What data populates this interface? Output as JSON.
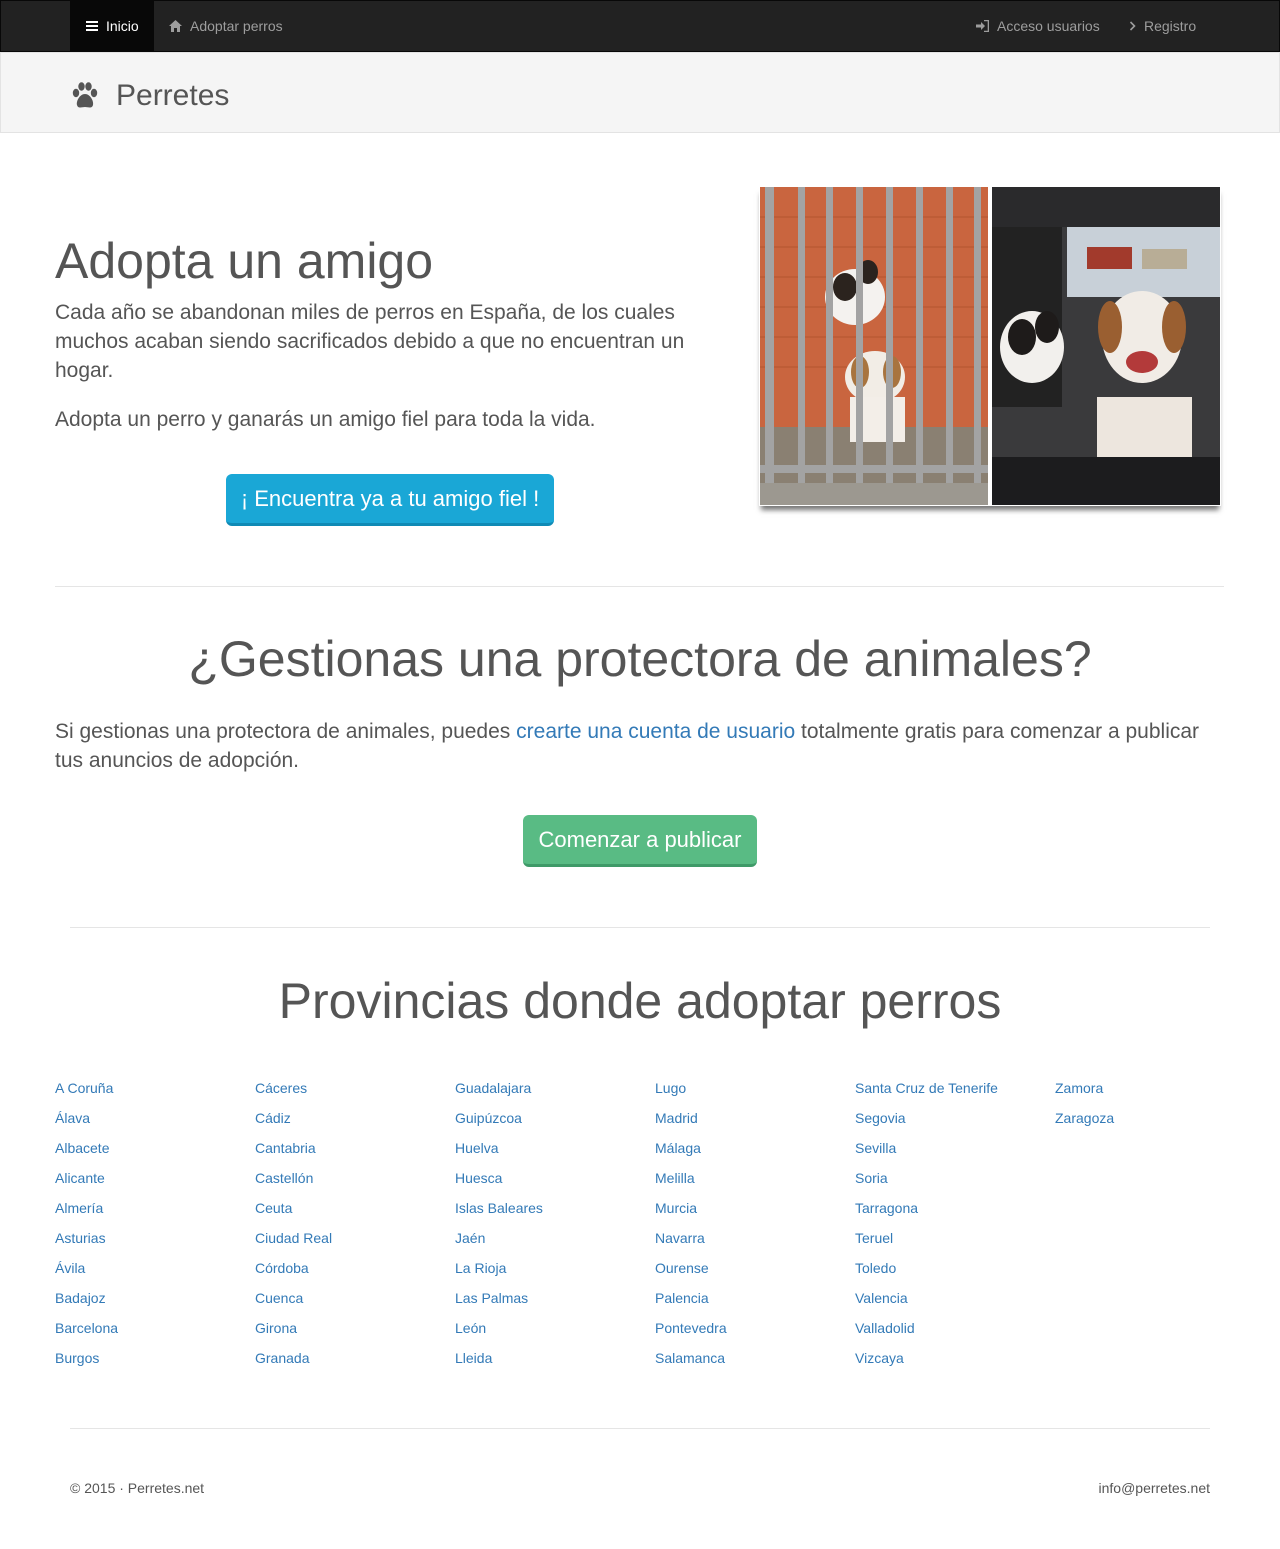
{
  "nav": {
    "inicio": "Inicio",
    "adoptar": "Adoptar perros",
    "acceso": "Acceso usuarios",
    "registro": "Registro"
  },
  "brand": {
    "name": "Perretes"
  },
  "hero": {
    "title": "Adopta un amigo",
    "paragraph1": "Cada año se abandonan miles de perros en España, de los cuales muchos acaban siendo sacrificados debido a que no encuentran un hogar.",
    "paragraph2": "Adopta un perro y ganarás un amigo fiel para toda la vida.",
    "button": "¡ Encuentra ya a tu amigo fiel !"
  },
  "protectora": {
    "title": "¿Gestionas una protectora de animales?",
    "text_before": "Si gestionas una protectora de animales, puedes ",
    "link": "crearte una cuenta de usuario",
    "text_after": " totalmente gratis para comenzar a publicar tus anuncios de adopción.",
    "button": "Comenzar a publicar"
  },
  "provincias": {
    "title": "Provincias donde adoptar perros",
    "columns": [
      [
        "A Coruña",
        "Álava",
        "Albacete",
        "Alicante",
        "Almería",
        "Asturias",
        "Ávila",
        "Badajoz",
        "Barcelona",
        "Burgos"
      ],
      [
        "Cáceres",
        "Cádiz",
        "Cantabria",
        "Castellón",
        "Ceuta",
        "Ciudad Real",
        "Córdoba",
        "Cuenca",
        "Girona",
        "Granada"
      ],
      [
        "Guadalajara",
        "Guipúzcoa",
        "Huelva",
        "Huesca",
        "Islas Baleares",
        "Jaén",
        "La Rioja",
        "Las Palmas",
        "León",
        "Lleida"
      ],
      [
        "Lugo",
        "Madrid",
        "Málaga",
        "Melilla",
        "Murcia",
        "Navarra",
        "Ourense",
        "Palencia",
        "Pontevedra",
        "Salamanca"
      ],
      [
        "Santa Cruz de Tenerife",
        "Segovia",
        "Sevilla",
        "Soria",
        "Tarragona",
        "Teruel",
        "Toledo",
        "Valencia",
        "Valladolid",
        "Vizcaya"
      ],
      [
        "Zamora",
        "Zaragoza"
      ]
    ]
  },
  "footer": {
    "copyright": "© 2015 · Perretes.net",
    "email": "info@perretes.net"
  },
  "colors": {
    "navbar": "#222222",
    "link": "#337ab7",
    "primary_button": "#1aa7d6",
    "success_button": "#59bb84"
  },
  "icons": {
    "inicio": "bars-icon",
    "adoptar": "home-icon",
    "acceso": "sign-in-icon",
    "registro": "chevron-right-icon",
    "brand": "paw-icon"
  }
}
